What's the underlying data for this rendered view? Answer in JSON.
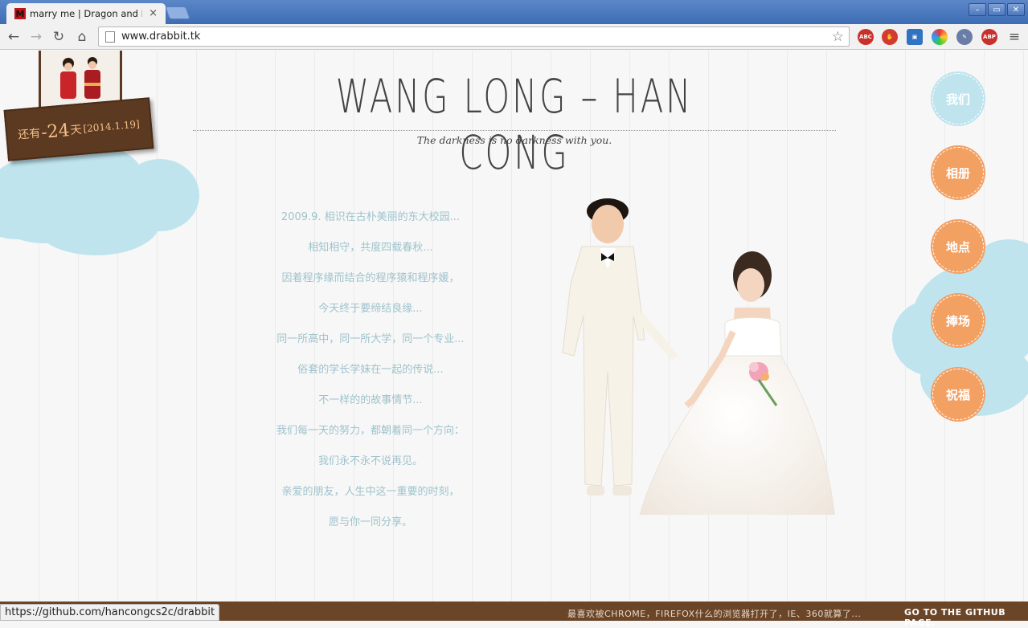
{
  "browser": {
    "tab_title": "marry me | Dragon and Ra",
    "tab_favicon": "M",
    "url": "www.drabbit.tk",
    "status_url": "https://github.com/hancongcs2c/drabbit",
    "window_controls": [
      "–",
      "▭",
      "✕"
    ]
  },
  "sign": {
    "prefix": "还有",
    "days": "-24",
    "suffix": "天",
    "date": "[2014.1.19]"
  },
  "header": {
    "title": "WANG LONG – HAN CONG",
    "tagline": "The darkness is no darkness with you."
  },
  "poem": [
    "2009.9. 相识在古朴美丽的东大校园...",
    "相知相守，共度四载春秋...",
    "因着程序缘而结合的程序猿和程序媛，",
    "今天终于要缔结良缘...",
    "同一所高中，同一所大学，同一个专业...",
    "俗套的学长学妹在一起的传说...",
    "不一样的的故事情节...",
    "我们每一天的努力，都朝着同一个方向：",
    "我们永不永不说再见。",
    "亲爱的朋友，人生中这一重要的时刻，",
    "愿与你一同分享。"
  ],
  "nav": [
    "我们",
    "相册",
    "地点",
    "捧场",
    "祝福"
  ],
  "footer": {
    "message": "最喜欢被CHROME，FIREFOX什么的浏览器打开了，IE、360就算了...",
    "link": "GO TO THE GITHUB PAGE."
  },
  "colors": {
    "accent_orange": "#f3a063",
    "accent_blue": "#bfe4ee",
    "footer_brown": "#6b4528",
    "sign_brown": "#5c3a22"
  }
}
